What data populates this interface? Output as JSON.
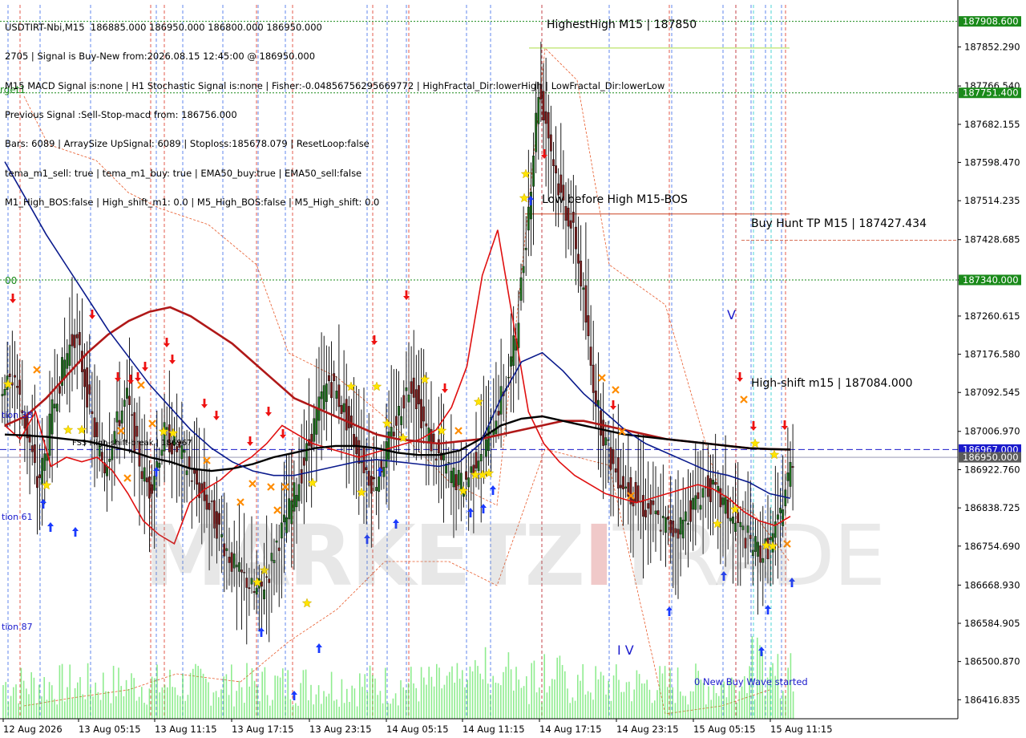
{
  "header": {
    "lines": [
      "USDTIRT-Nbi,M15  186885.000 186950.000 186800.000 186950.000",
      "2705 | Signal is Buy-New from:2026.08.15 12:45:00 @ 186950.000",
      "M15 MACD Signal is:none | H1 Stochastic Signal is:none | Fisher:-0.04856756295669772 | HighFractal_Dir:lowerHigh | LowFractal_Dir:lowerLow",
      "Previous Signal :Sell-Stop-macd from: 186756.000",
      "Bars: 6089 | ArraySize UpSignal: 6089 | Stoploss:185678.079 | ResetLoop:false",
      "tema_m1_sell: true | tema_m1_buy: true | EMA50_buy:true | EMA50_sell:false",
      "M1_High_BOS:false | High_shift_m1: 0.0 | M5_High_BOS:false | M5_High_shift: 0.0"
    ]
  },
  "watermark": {
    "part1": "MARKETZ",
    "part2": "I",
    "part3": "TRADE"
  },
  "colors": {
    "bull": "#1a6b1a",
    "bear": "#7a1a1a",
    "wick": "#000000",
    "ema_fast": "#e01010",
    "ema_slow": "#b01818",
    "ema_mid": "#000000",
    "ema_blue": "#0a1a8c",
    "level_green": "#1a8a1a",
    "level_blue": "#1a1acc",
    "level_red": "#cc2020",
    "up_arrow": "#1a3aff",
    "down_arrow": "#ee1111",
    "star": "#ffe400",
    "cross": "#ff8c00",
    "volume": "#33dd33"
  },
  "chart_data": {
    "type": "candlestick",
    "symbol": "USDTIRT-Nbi",
    "timeframe": "M15",
    "ylim": [
      186375,
      187945
    ],
    "y_ticks": [
      "187852.290",
      "187766.540",
      "187682.155",
      "187598.470",
      "187514.235",
      "187428.685",
      "187340.000",
      "187260.615",
      "187176.580",
      "187092.545",
      "187006.970",
      "186922.760",
      "186838.725",
      "186754.690",
      "186668.930",
      "186584.905",
      "186500.870",
      "186416.835"
    ],
    "x_ticks": [
      "12 Aug 2026",
      "13 Aug 05:15",
      "13 Aug 11:15",
      "13 Aug 17:15",
      "13 Aug 23:15",
      "14 Aug 05:15",
      "14 Aug 11:15",
      "14 Aug 17:15",
      "14 Aug 23:15",
      "15 Aug 05:15",
      "15 Aug 11:15"
    ],
    "price_tags": [
      {
        "label": "187908.600",
        "value": 187908.6,
        "color": "#1a8a1a"
      },
      {
        "label": "187751.400",
        "value": 187751.4,
        "color": "#1a8a1a"
      },
      {
        "label": "187340.000",
        "value": 187340.0,
        "color": "#1a8a1a"
      },
      {
        "label": "186967.000",
        "value": 186967.0,
        "color": "#1a1acc"
      },
      {
        "label": "186950.000",
        "value": 186950.0,
        "color": "#5a5a5a"
      }
    ],
    "annotations": [
      {
        "text": "HighestHigh   M15 | 187850",
        "value": 187850,
        "color": "#000000"
      },
      {
        "text": "Low before High   M15-BOS",
        "value": 187485,
        "color": "#000000"
      },
      {
        "text": "Buy Hunt TP M15 | 187427.434",
        "value": 187427.434,
        "color": "#000000"
      },
      {
        "text": "High-shift m15 | 187084.000",
        "value": 187084,
        "color": "#000000"
      },
      {
        "text": "FS3 High-shift-break | 186967",
        "value": 186967,
        "color": "#000000"
      },
      {
        "text": "V",
        "value": 187250,
        "color": "#1a1acc"
      },
      {
        "text": "I V",
        "value": 186535,
        "color": "#1a1acc"
      },
      {
        "text": "0 New Buy Wave started",
        "value": 186440,
        "color": "#1a1acc"
      },
      {
        "text": "rget1",
        "value": 187740,
        "color": "#1a8a1a"
      },
      {
        "text": "00",
        "value": 187320,
        "color": "#1a8a1a"
      },
      {
        "text": "tion 38",
        "value": 186990,
        "color": "#1a1acc"
      },
      {
        "text": "tion 61",
        "value": 186830,
        "color": "#1a1acc"
      },
      {
        "text": "tion 87",
        "value": 186608,
        "color": "#1a1acc"
      }
    ],
    "close_series": [
      187110,
      187130,
      187050,
      186980,
      186890,
      186950,
      187050,
      187120,
      187180,
      187220,
      187150,
      187060,
      186980,
      186930,
      186990,
      187040,
      187080,
      186990,
      186920,
      186880,
      186940,
      187000,
      186980,
      186960,
      186930,
      186900,
      186870,
      186840,
      186800,
      186760,
      186720,
      186690,
      186680,
      186650,
      186660,
      186700,
      186760,
      186800,
      186850,
      186900,
      186960,
      187020,
      187080,
      187120,
      187090,
      187050,
      187000,
      186960,
      186920,
      186890,
      186930,
      186980,
      187030,
      187080,
      187120,
      187060,
      187010,
      186970,
      186940,
      186920,
      186900,
      186890,
      186920,
      186960,
      186990,
      187030,
      187080,
      187130,
      187220,
      187380,
      187560,
      187760,
      187690,
      187600,
      187520,
      187480,
      187420,
      187300,
      187150,
      187050,
      186980,
      186930,
      186900,
      186880,
      186860,
      186840,
      186830,
      186810,
      186800,
      186790,
      186800,
      186830,
      186850,
      186880,
      186880,
      186860,
      186840,
      186810,
      186790,
      186770,
      186750,
      186740,
      186760,
      186800,
      186880,
      186950
    ],
    "series": [
      {
        "name": "EMA fast",
        "values": [
          187020,
          186990,
          187050,
          186930,
          186950,
          186940,
          186950,
          186920,
          186870,
          186810,
          186780,
          186760,
          186850,
          186880,
          186900,
          186930,
          186950,
          186980,
          187020,
          187000,
          186980,
          186970,
          186960,
          186950,
          186960,
          186970,
          186980,
          186990,
          187010,
          187060,
          187150,
          187350,
          187450,
          187250,
          187050,
          186980,
          186940,
          186910,
          186890,
          186870,
          186860,
          186850,
          186860,
          186870,
          186880,
          186890,
          186880,
          186860,
          186830,
          186810,
          186800,
          186820
        ]
      },
      {
        "name": "EMA slow",
        "values": [
          187020,
          187040,
          187080,
          187130,
          187180,
          187220,
          187250,
          187270,
          187280,
          187260,
          187230,
          187200,
          187160,
          187120,
          187080,
          187060,
          187040,
          187020,
          187000,
          186990,
          186985,
          186980,
          186985,
          186990,
          187000,
          187010,
          187020,
          187030,
          187030,
          187020,
          187010,
          187000,
          186990,
          186985,
          186980,
          186975,
          186970,
          186968,
          186967
        ]
      },
      {
        "name": "EMA mid",
        "values": [
          187000,
          186998,
          186995,
          186990,
          186985,
          186975,
          186965,
          186950,
          186940,
          186925,
          186920,
          186925,
          186935,
          186950,
          186960,
          186970,
          186975,
          186975,
          186970,
          186960,
          186955,
          186955,
          186965,
          186990,
          187020,
          187035,
          187040,
          187030,
          187020,
          187010,
          187000,
          186995,
          186990,
          186985,
          186980,
          186975,
          186970,
          186968,
          186967
        ]
      },
      {
        "name": "EMA blue",
        "values": [
          187600,
          187520,
          187440,
          187370,
          187300,
          187230,
          187170,
          187110,
          187060,
          187010,
          186970,
          186940,
          186920,
          186910,
          186910,
          186920,
          186930,
          186940,
          186945,
          186940,
          186935,
          186930,
          186940,
          186980,
          187080,
          187160,
          187180,
          187140,
          187090,
          187050,
          187010,
          186980,
          186960,
          186940,
          186920,
          186910,
          186895,
          186870,
          186860
        ]
      }
    ],
    "markers": {
      "up_arrows": [
        [
          54,
          628
        ],
        [
          63,
          657
        ],
        [
          94,
          663
        ],
        [
          195,
          588
        ],
        [
          326,
          788
        ],
        [
          367,
          867
        ],
        [
          398,
          808
        ],
        [
          458,
          672
        ],
        [
          474,
          588
        ],
        [
          494,
          653
        ],
        [
          587,
          639
        ],
        [
          603,
          634
        ],
        [
          615,
          611
        ],
        [
          662,
          250
        ],
        [
          835,
          762
        ],
        [
          903,
          718
        ],
        [
          950,
          812
        ],
        [
          958,
          760
        ],
        [
          988,
          726
        ]
      ],
      "down_arrows": [
        [
          16,
          372
        ],
        [
          115,
          392
        ],
        [
          147,
          470
        ],
        [
          163,
          473
        ],
        [
          172,
          470
        ],
        [
          181,
          457
        ],
        [
          208,
          427
        ],
        [
          215,
          448
        ],
        [
          255,
          503
        ],
        [
          270,
          518
        ],
        [
          312,
          550
        ],
        [
          335,
          513
        ],
        [
          353,
          541
        ],
        [
          467,
          424
        ],
        [
          507,
          368
        ],
        [
          555,
          484
        ],
        [
          679,
          192
        ],
        [
          765,
          505
        ],
        [
          923,
          470
        ],
        [
          940,
          531
        ],
        [
          979,
          530
        ]
      ],
      "stars": [
        [
          10,
          479
        ],
        [
          58,
          605
        ],
        [
          85,
          536
        ],
        [
          102,
          536
        ],
        [
          204,
          538
        ],
        [
          216,
          540
        ],
        [
          321,
          726
        ],
        [
          330,
          711
        ],
        [
          383,
          752
        ],
        [
          390,
          602
        ],
        [
          438,
          482
        ],
        [
          451,
          614
        ],
        [
          470,
          482
        ],
        [
          483,
          528
        ],
        [
          503,
          546
        ],
        [
          530,
          473
        ],
        [
          551,
          537
        ],
        [
          578,
          612
        ],
        [
          593,
          592
        ],
        [
          597,
          501
        ],
        [
          602,
          592
        ],
        [
          610,
          590
        ],
        [
          656,
          217
        ],
        [
          654,
          247
        ],
        [
          895,
          653
        ],
        [
          917,
          635
        ],
        [
          942,
          553
        ],
        [
          956,
          680
        ],
        [
          966,
          567
        ],
        [
          964,
          681
        ]
      ],
      "crosses": [
        [
          46,
          461
        ],
        [
          151,
          537
        ],
        [
          159,
          596
        ],
        [
          176,
          480
        ],
        [
          190,
          528
        ],
        [
          258,
          574
        ],
        [
          300,
          626
        ],
        [
          315,
          603
        ],
        [
          338,
          607
        ],
        [
          346,
          636
        ],
        [
          356,
          607
        ],
        [
          572,
          537
        ],
        [
          751,
          471
        ],
        [
          768,
          486
        ],
        [
          776,
          538
        ],
        [
          787,
          618
        ],
        [
          928,
          498
        ],
        [
          982,
          678
        ]
      ]
    }
  }
}
